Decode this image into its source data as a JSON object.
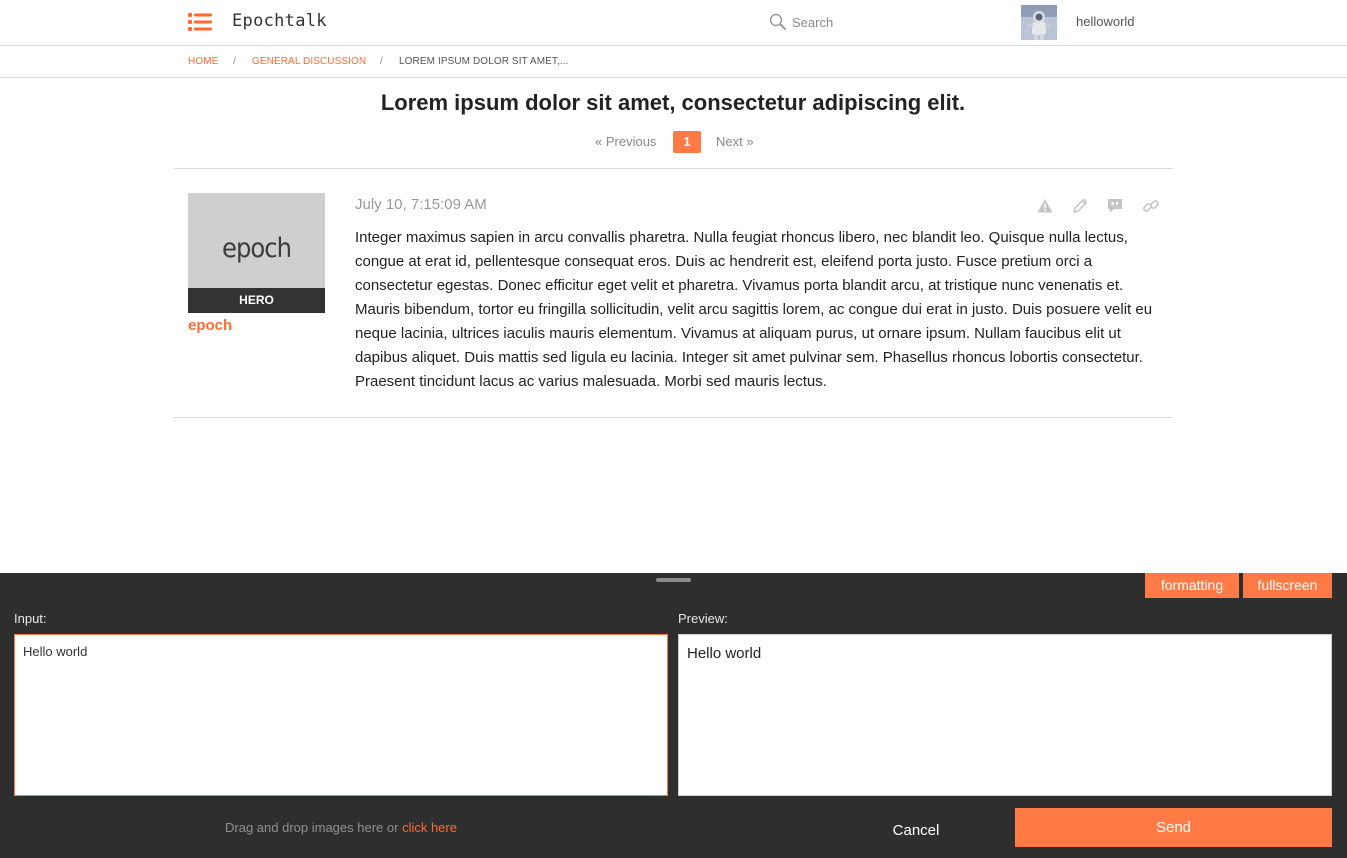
{
  "header": {
    "brand": "Epochtalk",
    "search_placeholder": "Search",
    "username": "helloworld"
  },
  "breadcrumbs": [
    {
      "label": "HOME"
    },
    {
      "label": "GENERAL DISCUSSION"
    },
    {
      "label": "LOREM IPSUM DOLOR SIT AMET,..."
    }
  ],
  "breadcrumb_separator": "/",
  "thread": {
    "title": "Lorem ipsum dolor sit amet, consectetur adipiscing elit.",
    "pagination": {
      "prev_label": "« Previous",
      "current_page": "1",
      "next_label": "Next »"
    }
  },
  "post": {
    "author": "epoch",
    "avatar_text": "epoch",
    "rank": "HERO",
    "date": "July 10, 7:15:09 AM",
    "body": "Integer maximus sapien in arcu convallis pharetra. Nulla feugiat rhoncus libero, nec blandit leo. Quisque nulla lectus, congue at erat id, pellentesque consequat eros. Duis ac hendrerit est, eleifend porta justo. Fusce pretium orci a consectetur egestas. Donec efficitur eget velit et pharetra. Vivamus porta blandit arcu, at tristique nunc venenatis et. Mauris bibendum, tortor eu fringilla sollicitudin, velit arcu sagittis lorem, ac congue dui erat in justo. Duis posuere velit eu neque lacinia, ultrices iaculis mauris elementum. Vivamus at aliquam purus, ut ornare ipsum. Nullam faucibus elit ut dapibus aliquet. Duis mattis sed ligula eu lacinia. Integer sit amet pulvinar sem. Phasellus rhoncus lobortis consectetur. Praesent tincidunt lacus ac varius malesuada. Morbi sed mauris lectus.",
    "actions": [
      "report-icon",
      "edit-icon",
      "quote-icon",
      "link-icon"
    ]
  },
  "editor": {
    "formatting_label": "formatting",
    "fullscreen_label": "fullscreen",
    "input_label": "Input:",
    "preview_label": "Preview:",
    "input_value": "Hello world",
    "preview_text": "Hello world",
    "upload_hint": "Drag and drop images here or",
    "upload_link": "click here",
    "cancel_label": "Cancel",
    "send_label": "Send"
  },
  "colors": {
    "accent": "#ff7a45",
    "editor_bg": "#2e2e2e",
    "rank_bg": "#333333",
    "avatar_bg": "#cfcfcf"
  }
}
